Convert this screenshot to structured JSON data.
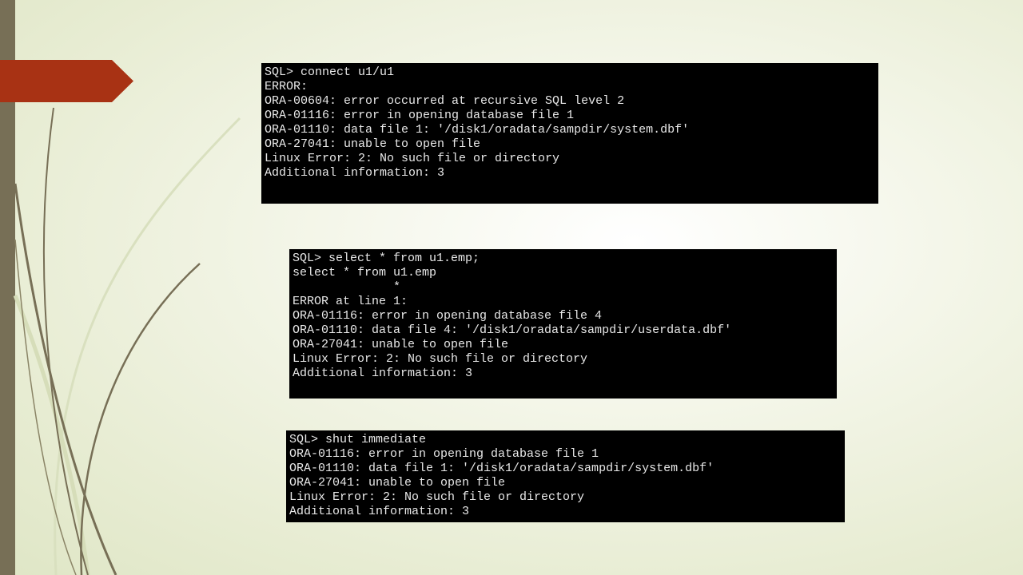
{
  "slide": {
    "colors": {
      "left_bar": "#776f56",
      "arrow_tab": "#a83214",
      "terminal_bg": "#000000",
      "terminal_text": "#e8e8e8"
    },
    "terminals": [
      {
        "lines": [
          "SQL> connect u1/u1",
          "ERROR:",
          "ORA-00604: error occurred at recursive SQL level 2",
          "ORA-01116: error in opening database file 1",
          "ORA-01110: data file 1: '/disk1/oradata/sampdir/system.dbf'",
          "ORA-27041: unable to open file",
          "Linux Error: 2: No such file or directory",
          "Additional information: 3"
        ]
      },
      {
        "lines": [
          "SQL> select * from u1.emp;",
          "select * from u1.emp",
          "              *",
          "ERROR at line 1:",
          "ORA-01116: error in opening database file 4",
          "ORA-01110: data file 4: '/disk1/oradata/sampdir/userdata.dbf'",
          "ORA-27041: unable to open file",
          "Linux Error: 2: No such file or directory",
          "Additional information: 3"
        ]
      },
      {
        "lines": [
          "SQL> shut immediate",
          "ORA-01116: error in opening database file 1",
          "ORA-01110: data file 1: '/disk1/oradata/sampdir/system.dbf'",
          "ORA-27041: unable to open file",
          "Linux Error: 2: No such file or directory",
          "Additional information: 3"
        ]
      }
    ]
  }
}
